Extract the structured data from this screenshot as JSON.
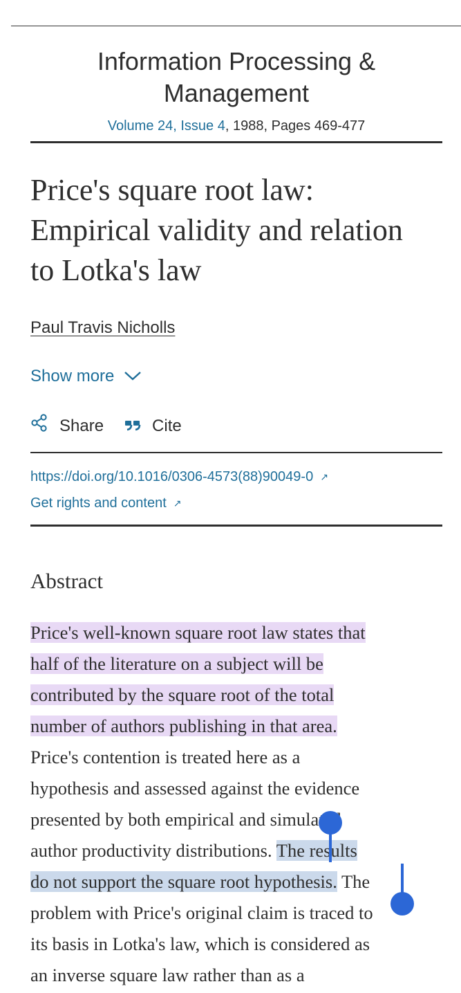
{
  "journal": {
    "title_line1": "Information Processing &",
    "title_line2": "Management",
    "volume_issue": "Volume 24, Issue 4",
    "meta_rest": ", 1988, Pages 469-477"
  },
  "article": {
    "title_line1": "Price's square root law:",
    "title_line2": "Empirical validity and relation",
    "title_line3": "to Lotka's law",
    "author": "Paul Travis Nicholls"
  },
  "controls": {
    "show_more": "Show more",
    "share": "Share",
    "cite": "Cite"
  },
  "links": {
    "doi": "https://doi.org/10.1016/0306-4573(88)90049-0",
    "rights": "Get rights and content"
  },
  "abstract": {
    "heading": "Abstract",
    "lines": [
      "Price's well-known square root law states that",
      "half of the literature on a subject will be",
      "contributed by the square root of the total",
      "number of authors publishing in that area.",
      "Price's contention is treated here as a",
      "hypothesis and assessed against the evidence",
      "presented by both empirical and simulated",
      "author productivity distributions. ",
      "The results",
      "do not support the square root hypothesis.",
      " The",
      "problem with Price's original claim is traced to",
      "its basis in Lotka's law, which is considered as",
      "an inverse square law rather than as a"
    ]
  },
  "colors": {
    "link": "#1f6f9a",
    "highlight_purple": "#e8d9f5",
    "highlight_blue": "#cbd9eb",
    "selection_handle": "#2c67d6"
  }
}
